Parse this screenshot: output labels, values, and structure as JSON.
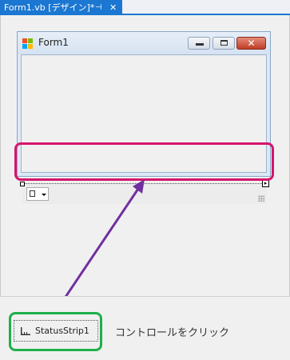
{
  "document_tab": {
    "title": "Form1.vb [デザイン]*",
    "pin_glyph": "⊣",
    "close_glyph": "✕"
  },
  "form": {
    "title": "Form1",
    "icon": "windows-form-icon",
    "caption_buttons": [
      "minimize-icon",
      "maximize-icon",
      "close-icon"
    ],
    "close_glyph": "✕"
  },
  "status_strip": {
    "dropdown_icon": "status-label-icon",
    "smart_tag_glyph": "▸"
  },
  "component_tray": {
    "item_label": "StatusStrip1",
    "item_icon": "statusstrip-icon"
  },
  "annotation": {
    "instruction": "コントロールをクリック",
    "strip_highlight_color": "#d6156c",
    "tray_highlight_color": "#1faf4b",
    "arrow_color": "#7030a0"
  }
}
